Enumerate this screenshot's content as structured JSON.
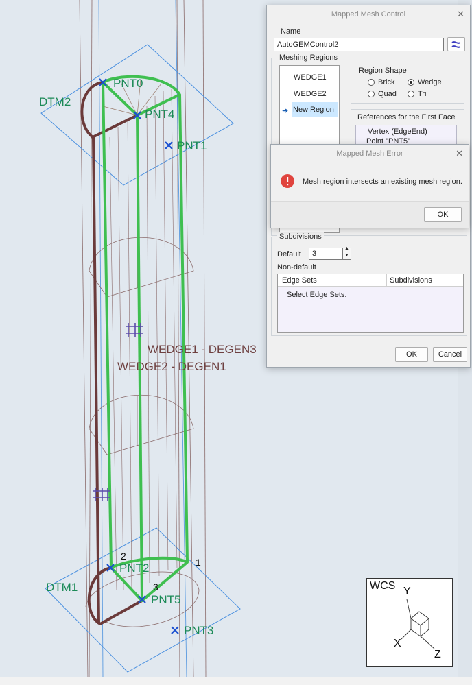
{
  "viewport": {
    "labels": {
      "dtm2": "DTM2",
      "dtm1": "DTM1",
      "pnt0": "PNT0",
      "pnt4": "PNT4",
      "pnt1": "PNT1",
      "pnt2": "PNT2",
      "pnt5": "PNT5",
      "pnt3": "PNT3",
      "region1": "WEDGE1 - DEGEN3",
      "region2": "WEDGE2 - DEGEN1",
      "num1": "1",
      "num2": "2",
      "num3": "3"
    },
    "colors": {
      "datum_plane": "#3f8ad8",
      "green_edge": "#3fbf50",
      "brown_edge": "#6b3a3a",
      "mesh_line": "#9a7a6a",
      "point_marker": "#1a4fd0"
    }
  },
  "wcs": {
    "title": "WCS",
    "x": "X",
    "y": "Y",
    "z": "Z"
  },
  "mesh_dialog": {
    "title": "Mapped Mesh Control",
    "name_label": "Name",
    "name_value": "AutoGEMControl2",
    "meshing_regions_label": "Meshing Regions",
    "regions": [
      "WEDGE1",
      "WEDGE2",
      "New Region"
    ],
    "region_shape_label": "Region Shape",
    "shapes": {
      "brick": "Brick",
      "wedge": "Wedge",
      "quad": "Quad",
      "tri": "Tri"
    },
    "selected_shape": "Wedge",
    "references_label": "References for the First Face",
    "references": [
      "Vertex (EdgeEnd)",
      "Point \"PNT5\""
    ],
    "subdivisions_label": "Subdivisions",
    "default_label": "Default",
    "default_value": "3",
    "non_default_label": "Non-default",
    "table_headers": [
      "Edge Sets",
      "Subdivisions"
    ],
    "table_placeholder": "Select Edge Sets.",
    "ok": "OK",
    "cancel": "Cancel"
  },
  "error_dialog": {
    "title": "Mapped Mesh Error",
    "message": "Mesh region intersects an existing mesh region.",
    "ok": "OK"
  }
}
